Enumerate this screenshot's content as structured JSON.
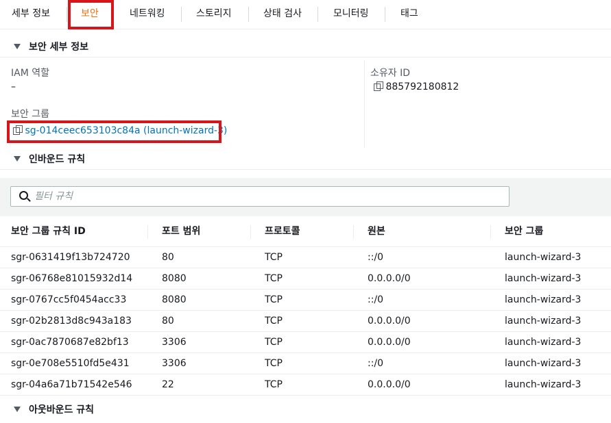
{
  "tabs": [
    {
      "label": "세부 정보",
      "active": false
    },
    {
      "label": "보안",
      "active": true
    },
    {
      "label": "네트워킹",
      "active": false
    },
    {
      "label": "스토리지",
      "active": false
    },
    {
      "label": "상태 검사",
      "active": false
    },
    {
      "label": "모니터링",
      "active": false
    },
    {
      "label": "태그",
      "active": false
    }
  ],
  "security_details": {
    "title": "보안 세부 정보",
    "iam_role_label": "IAM 역할",
    "iam_role_value": "–",
    "owner_id_label": "소유자 ID",
    "owner_id_value": "885792180812",
    "security_groups_label": "보안 그룹",
    "security_group_link": "sg-014ceec653103c84a (launch-wizard-3)"
  },
  "inbound_rules": {
    "title": "인바운드 규칙",
    "filter_placeholder": "필터 규칙",
    "columns": [
      "보안 그룹 규칙 ID",
      "포트 범위",
      "프로토콜",
      "원본",
      "보안 그룹"
    ],
    "rows": [
      [
        "sgr-0631419f13b724720",
        "80",
        "TCP",
        "::/0",
        "launch-wizard-3"
      ],
      [
        "sgr-06768e81015932d14",
        "8080",
        "TCP",
        "0.0.0.0/0",
        "launch-wizard-3"
      ],
      [
        "sgr-0767cc5f0454acc33",
        "8080",
        "TCP",
        "::/0",
        "launch-wizard-3"
      ],
      [
        "sgr-02b2813d8c943a183",
        "80",
        "TCP",
        "0.0.0.0/0",
        "launch-wizard-3"
      ],
      [
        "sgr-0ac7870687e82bf13",
        "3306",
        "TCP",
        "0.0.0.0/0",
        "launch-wizard-3"
      ],
      [
        "sgr-0e708e5510fd5e431",
        "3306",
        "TCP",
        "::/0",
        "launch-wizard-3"
      ],
      [
        "sgr-04a6a71b71542e546",
        "22",
        "TCP",
        "0.0.0.0/0",
        "launch-wizard-3"
      ]
    ]
  },
  "outbound_rules": {
    "title": "아웃바운드 규칙"
  },
  "colors": {
    "accent": "#ec7211",
    "link": "#0073bb",
    "highlight_box": "#d6161b"
  }
}
